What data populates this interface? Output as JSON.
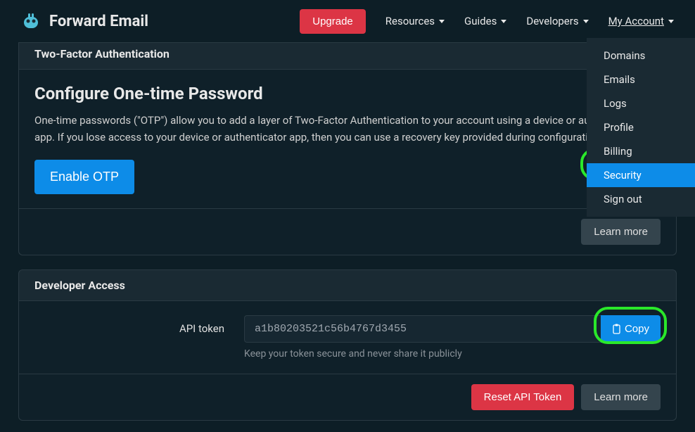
{
  "navbar": {
    "brand": "Forward Email",
    "upgrade": "Upgrade",
    "resources": "Resources",
    "guides": "Guides",
    "developers": "Developers",
    "myAccount": "My Account"
  },
  "dropdown": {
    "items": [
      {
        "label": "Domains"
      },
      {
        "label": "Emails"
      },
      {
        "label": "Logs"
      },
      {
        "label": "Profile"
      },
      {
        "label": "Billing"
      },
      {
        "label": "Security"
      },
      {
        "label": "Sign out"
      }
    ]
  },
  "twoFactor": {
    "sectionTitle": "Two-Factor Authentication",
    "heading": "Configure One-time Password",
    "description": "One-time passwords (\"OTP\") allow you to add a layer of Two-Factor Authentication to your account using a device or authenticator app. If you lose access to your device or authenticator app, then you can use a recovery key provided during configuration.",
    "enableButton": "Enable OTP",
    "learnMore": "Learn more"
  },
  "developer": {
    "sectionTitle": "Developer Access",
    "apiTokenLabel": "API token",
    "apiTokenValue": "a1b80203521c56b4767d3455",
    "helpText": "Keep your token secure and never share it publicly",
    "copyButton": "Copy",
    "resetButton": "Reset API Token",
    "learnMore": "Learn more"
  }
}
